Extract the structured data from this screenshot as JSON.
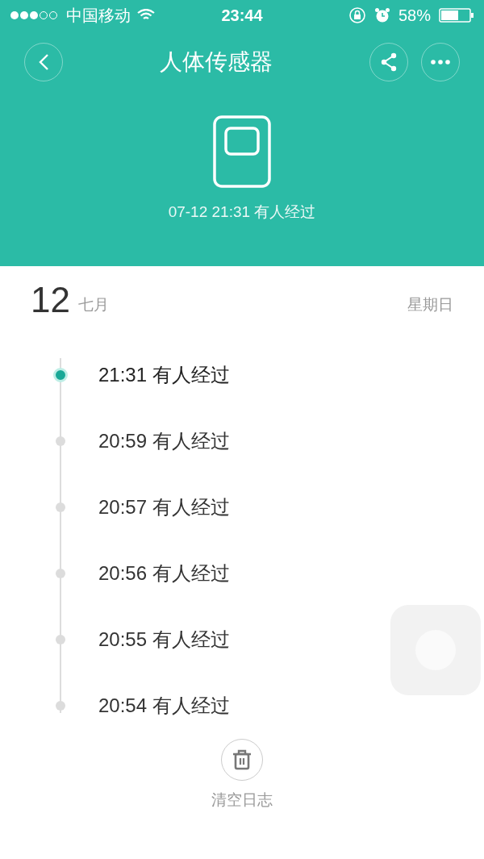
{
  "status_bar": {
    "carrier": "中国移动",
    "time": "23:44",
    "battery": "58%"
  },
  "header": {
    "title": "人体传感器",
    "last_event": "07-12 21:31 有人经过"
  },
  "day": {
    "date": "12",
    "month": "七月",
    "weekday": "星期日"
  },
  "log": [
    {
      "text": "21:31 有人经过",
      "selected": true
    },
    {
      "text": "20:59 有人经过",
      "selected": false
    },
    {
      "text": "20:57 有人经过",
      "selected": false
    },
    {
      "text": "20:56 有人经过",
      "selected": false
    },
    {
      "text": "20:55 有人经过",
      "selected": false
    },
    {
      "text": "20:54 有人经过",
      "selected": false
    }
  ],
  "clear_button": {
    "label": "清空日志"
  }
}
